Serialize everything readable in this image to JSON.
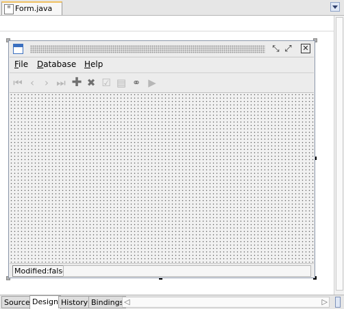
{
  "editor_tab": {
    "icon": "java-file-icon",
    "label": "Form.java"
  },
  "form": {
    "menu": [
      {
        "label": "File",
        "mnemonic": "F",
        "rest": "ile"
      },
      {
        "label": "Database",
        "mnemonic": "D",
        "rest": "atabase"
      },
      {
        "label": "Help",
        "mnemonic": "H",
        "rest": "elp"
      }
    ],
    "title_buttons": [
      "minimize-icon",
      "maximize-icon",
      "close-icon"
    ],
    "toolbar_icons": [
      "first-record-icon",
      "previous-record-icon",
      "next-record-icon",
      "last-record-icon",
      "add-icon",
      "delete-icon",
      "commit-icon",
      "rollback-icon",
      "find-icon",
      "execute-icon"
    ],
    "status": {
      "text": "Modified:false"
    }
  },
  "bottom_tabs": [
    {
      "label": "Source",
      "active": false
    },
    {
      "label": "Design",
      "active": true
    },
    {
      "label": "History",
      "active": false
    },
    {
      "label": "Bindings",
      "active": false
    }
  ]
}
